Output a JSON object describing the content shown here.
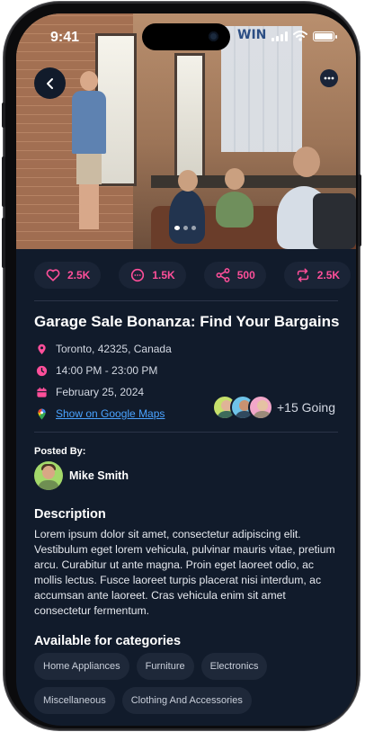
{
  "status_bar": {
    "time": "9:41"
  },
  "hero": {
    "whiteboard_text": "WIN"
  },
  "stats": [
    {
      "icon": "heart-icon",
      "value": "2.5K"
    },
    {
      "icon": "comment-icon",
      "value": "1.5K"
    },
    {
      "icon": "share-icon",
      "value": "500"
    },
    {
      "icon": "repost-icon",
      "value": "2.5K"
    }
  ],
  "event": {
    "title": "Garage Sale Bonanza: Find Your Bargains",
    "location": "Toronto, 42325, Canada",
    "time": "14:00 PM - 23:00 PM",
    "date": "February 25, 2024",
    "maps_link": "Show on Google Maps",
    "going": "+15 Going"
  },
  "posted_by": {
    "label": "Posted By:",
    "name": "Mike Smith"
  },
  "description": {
    "heading": "Description",
    "text": "Lorem ipsum dolor sit amet, consectetur adipiscing elit. Vestibulum eget lorem vehicula, pulvinar mauris vitae, pretium arcu. Curabitur ut ante magna. Proin eget laoreet odio, ac mollis lectus. Fusce laoreet turpis placerat nisi interdum, ac accumsan ante laoreet. Cras vehicula enim sit amet consectetur fermentum."
  },
  "categories": {
    "heading": "Available for categories",
    "items": [
      "Home Appliances",
      "Furniture",
      "Electronics",
      "Miscellaneous",
      "Clothing And Accessories"
    ]
  },
  "colors": {
    "accent": "#ff4f9a",
    "background": "#111b2b",
    "link": "#4aa3ff",
    "chip": "#1e2839"
  }
}
